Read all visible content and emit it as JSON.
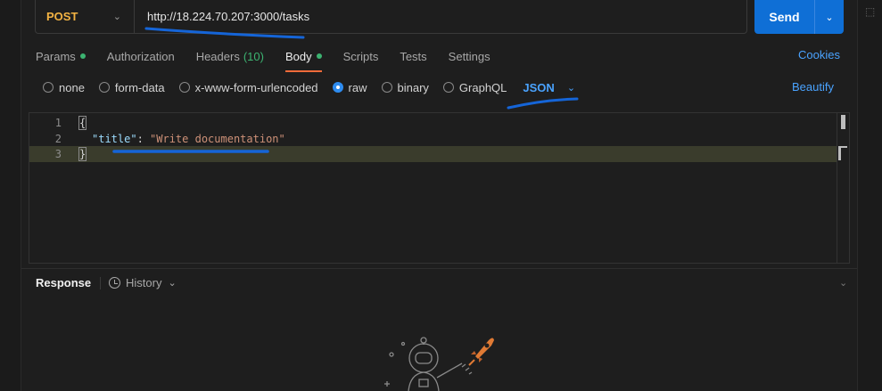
{
  "request": {
    "method": "POST",
    "url": "http://18.224.70.207:3000/tasks",
    "send_label": "Send"
  },
  "tabs": [
    {
      "label": "Params",
      "dot": true
    },
    {
      "label": "Authorization"
    },
    {
      "label": "Headers",
      "count": "(10)"
    },
    {
      "label": "Body",
      "dot": true,
      "active": true
    },
    {
      "label": "Scripts"
    },
    {
      "label": "Tests"
    },
    {
      "label": "Settings"
    }
  ],
  "cookies_label": "Cookies",
  "body_types": [
    {
      "label": "none",
      "selected": false
    },
    {
      "label": "form-data",
      "selected": false
    },
    {
      "label": "x-www-form-urlencoded",
      "selected": false
    },
    {
      "label": "raw",
      "selected": true
    },
    {
      "label": "binary",
      "selected": false
    },
    {
      "label": "GraphQL",
      "selected": false
    }
  ],
  "raw_format": "JSON",
  "beautify_label": "Beautify",
  "editor": {
    "lines": [
      {
        "num": "1",
        "text": "{"
      },
      {
        "num": "2",
        "key": "\"title\"",
        "sep": ": ",
        "value": "\"Write documentation\""
      },
      {
        "num": "3",
        "text": "}"
      }
    ]
  },
  "response": {
    "label": "Response",
    "history_label": "History"
  },
  "colors": {
    "accent_blue": "#0f6fd6",
    "method_post": "#f3b343",
    "tab_underline": "#f26b3a",
    "dot_green": "#3cb371"
  },
  "icons": [
    "chevron-down-icon",
    "radio-icon",
    "clock-icon",
    "rocket-icon",
    "astronaut-icon"
  ]
}
